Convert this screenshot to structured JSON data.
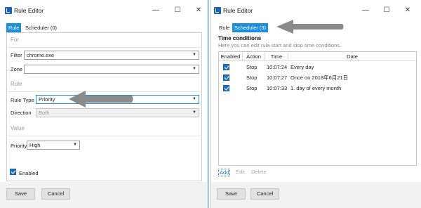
{
  "left": {
    "title": "Rule Editor",
    "tabs": [
      {
        "label": "Rule"
      },
      {
        "label": "Scheduler (0)"
      }
    ],
    "sections": {
      "for": "For",
      "rule": "Rule",
      "value": "Value"
    },
    "filter": {
      "label": "Filter",
      "value": "chrome.exe"
    },
    "zone": {
      "label": "Zone",
      "value": ""
    },
    "rule_type": {
      "label": "Rule Type",
      "value": "Priority"
    },
    "direction": {
      "label": "Direction",
      "value": "Both"
    },
    "priority": {
      "label": "Priority",
      "value": "High"
    },
    "enabled": {
      "label": "Enabled",
      "checked": true
    },
    "buttons": {
      "save": "Save",
      "cancel": "Cancel"
    }
  },
  "right": {
    "title": "Rule Editor",
    "tabs": [
      {
        "label": "Rule"
      },
      {
        "label": "Scheduler (3)"
      }
    ],
    "time_conditions": {
      "title": "Time conditions",
      "subtitle": "Here you can edit rule start and stop time conditions."
    },
    "columns": [
      "Enabled",
      "Action",
      "Time",
      "Date"
    ],
    "rows": [
      {
        "enabled": true,
        "action": "Stop",
        "time": "10:07:24",
        "date": "Every day"
      },
      {
        "enabled": true,
        "action": "Stop",
        "time": "10:07:27",
        "date": "Once on 2018年6月21日"
      },
      {
        "enabled": true,
        "action": "Stop",
        "time": "10:07:33",
        "date": "1. day of every month"
      }
    ],
    "actions": {
      "add": "Add",
      "edit": "Edit",
      "delete": "Delete"
    },
    "buttons": {
      "save": "Save",
      "cancel": "Cancel"
    }
  },
  "window_controls": {
    "minimize": "—",
    "maximize": "☐",
    "close": "✕"
  },
  "colors": {
    "accent": "#1a8fe0",
    "checkbox": "#1a73c9",
    "annotation_arrow": "#8a8a8a"
  }
}
